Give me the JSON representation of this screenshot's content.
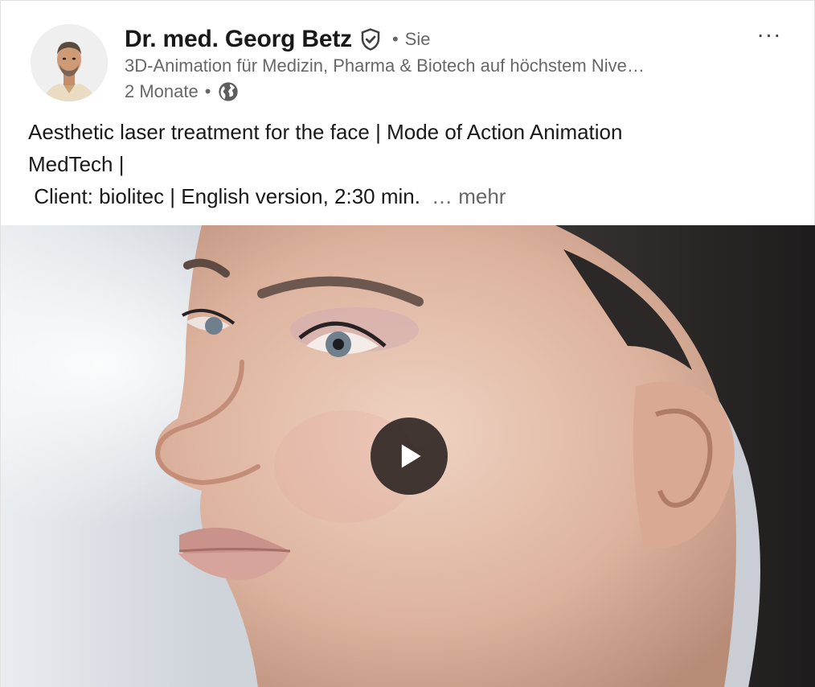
{
  "author": {
    "name": "Dr. med. Georg Betz",
    "degree": "Sie",
    "headline": "3D-Animation für Medizin, Pharma & Biotech auf höchstem Nive…",
    "age": "2 Monate",
    "verified_icon": "verified-shield-icon",
    "visibility_icon": "globe-icon"
  },
  "post": {
    "lines": [
      "Aesthetic laser treatment for the face | Mode of Action Animation",
      "MedTech |",
      " Client: biolitec | English version, 2:30 min."
    ],
    "see_more": "… mehr"
  },
  "menu": {
    "more_label": "···"
  },
  "video": {
    "play_icon": "play-icon"
  }
}
